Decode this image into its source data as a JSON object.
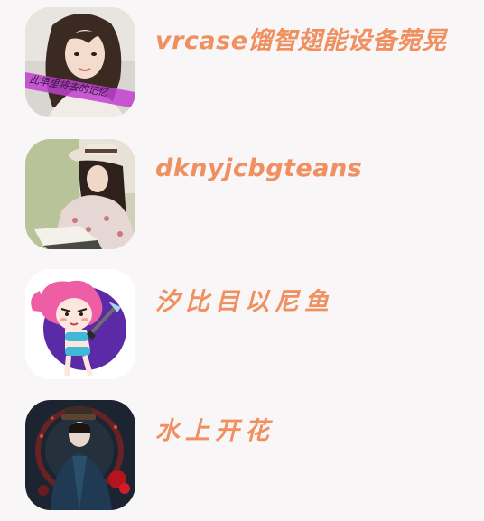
{
  "contacts": [
    {
      "name": "vrcase馏智翅能设备菀晃",
      "avatar_icon": "avatar-girl-portrait",
      "avatar_caption": "此早里将去的记忆"
    },
    {
      "name": "dknyjcbgteans",
      "avatar_icon": "avatar-girl-with-hat-reading"
    },
    {
      "name": "汐比目以尼鱼",
      "avatar_icon": "avatar-cartoon-pink-hair-warrior"
    },
    {
      "name": "水上开花",
      "avatar_icon": "avatar-ancient-costume-figure"
    }
  ],
  "colors": {
    "name_text": "#f09060",
    "background": "#f8f6f7"
  }
}
